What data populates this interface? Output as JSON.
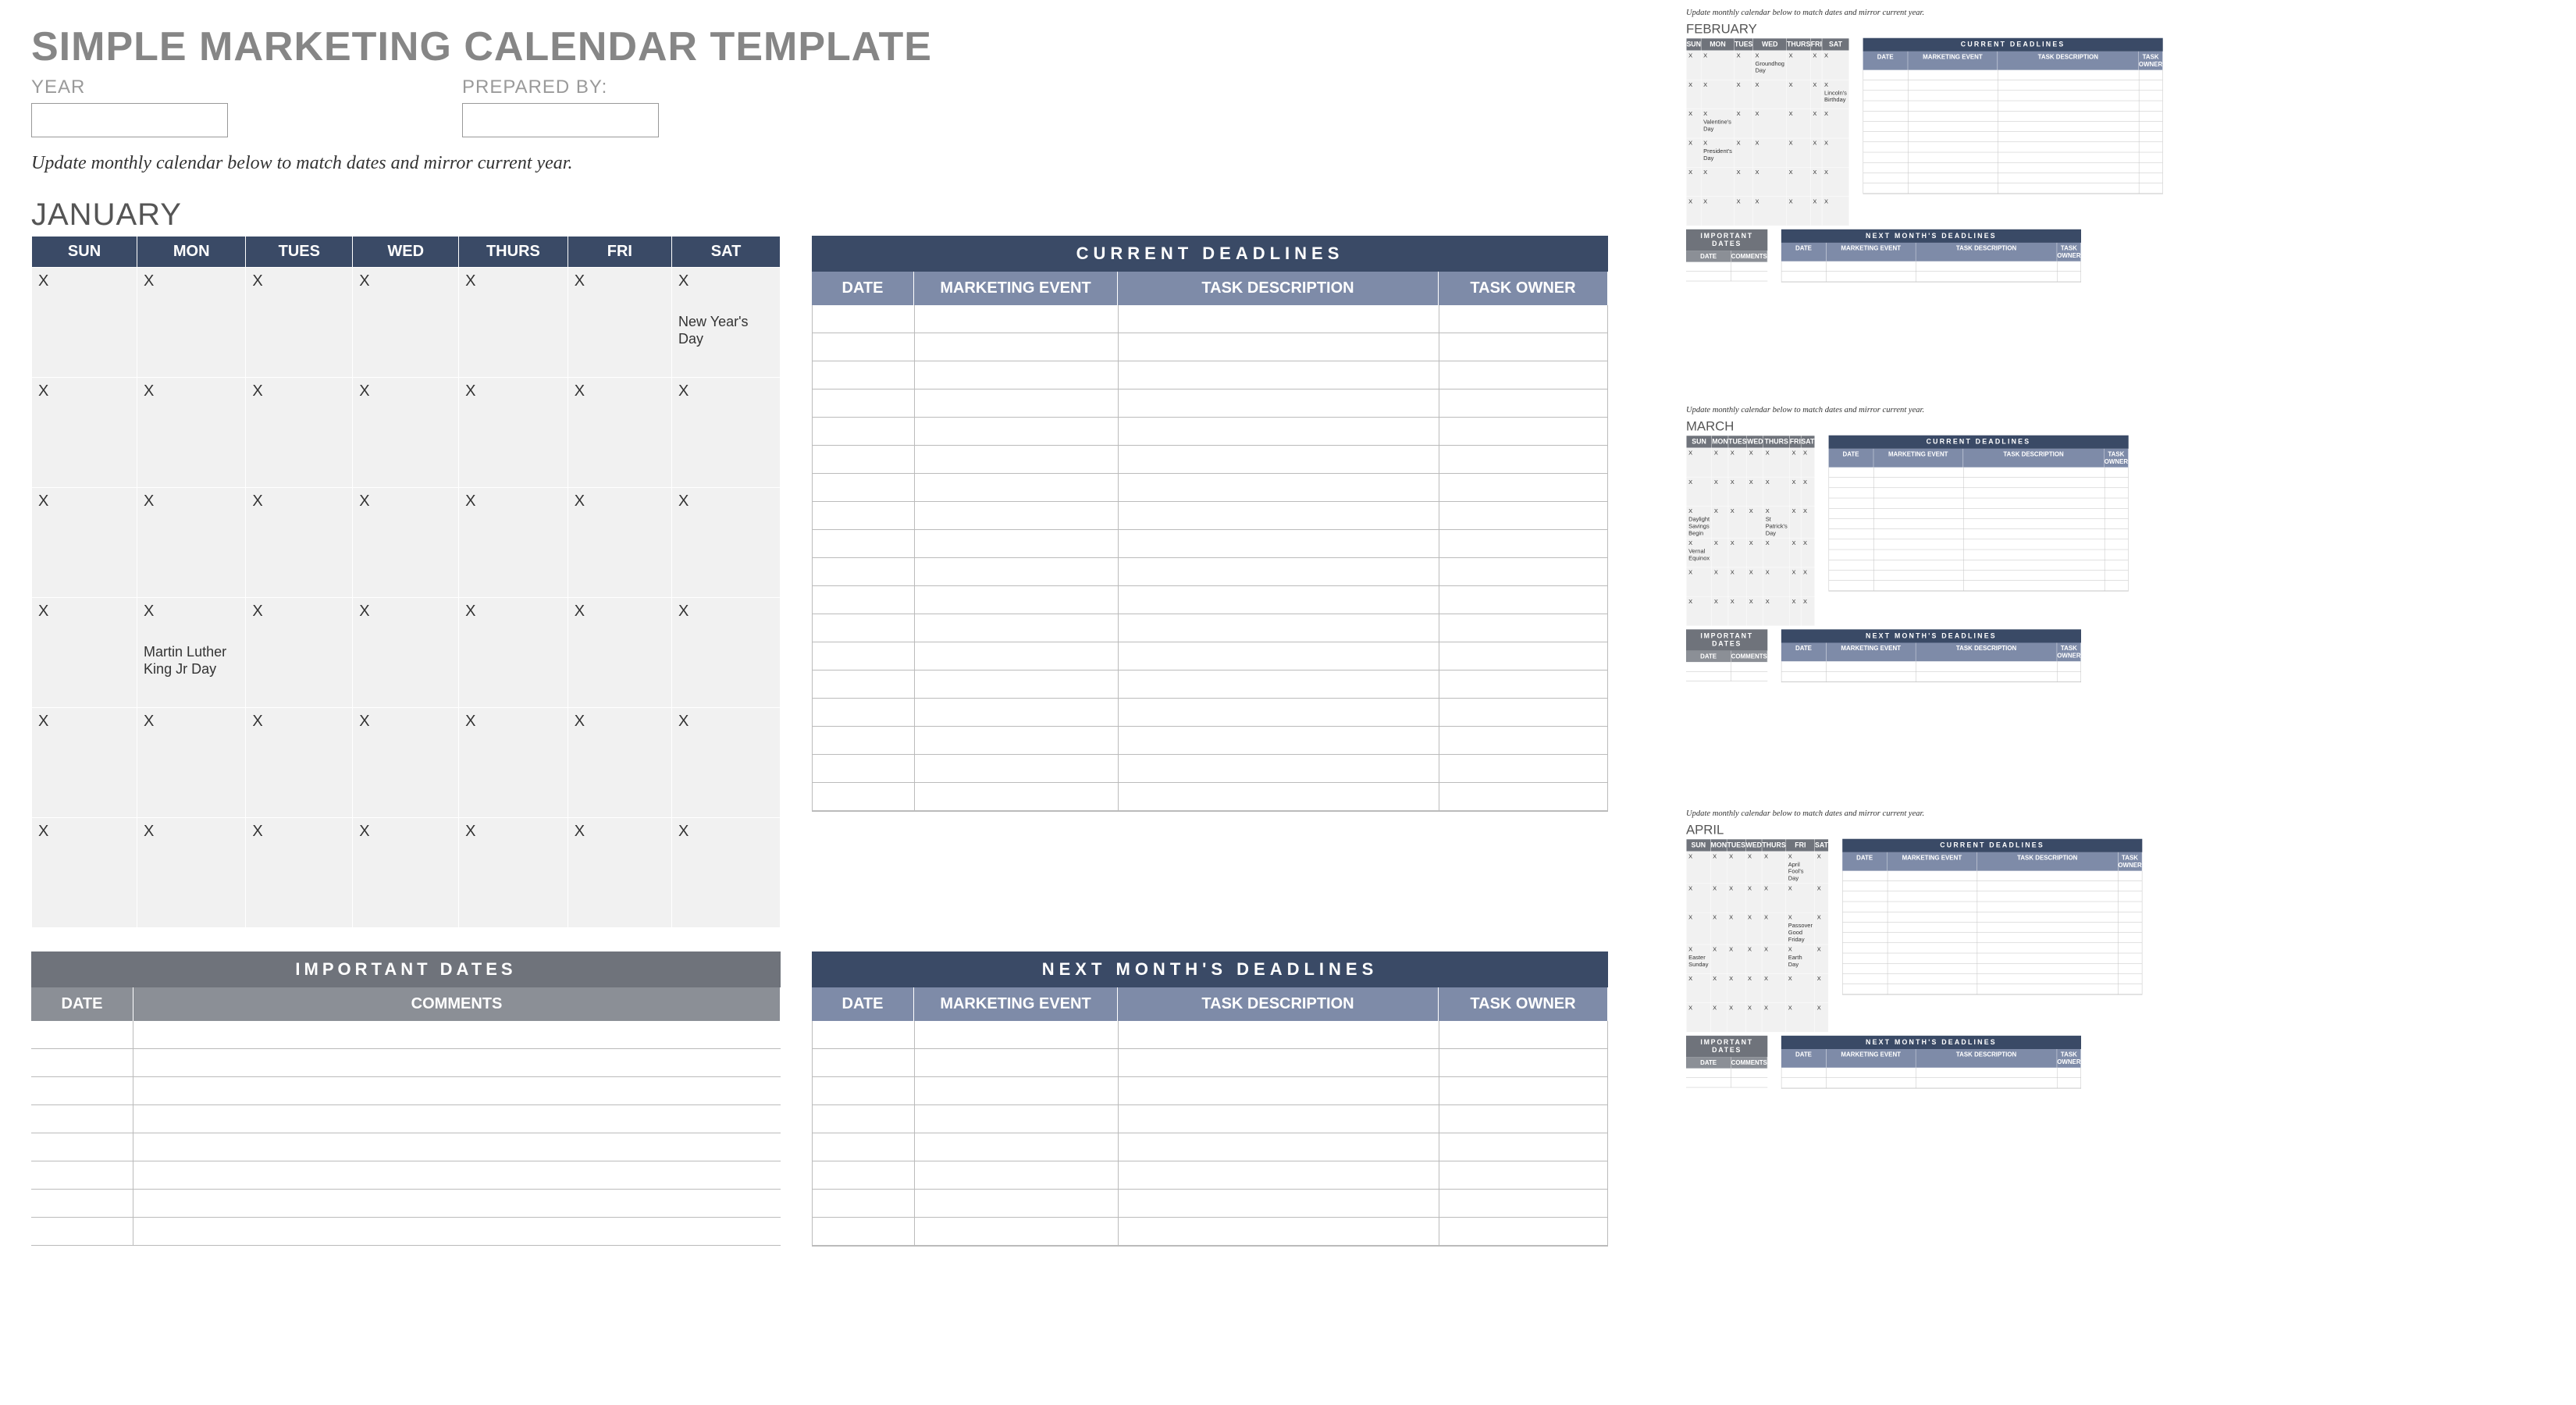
{
  "title": "SIMPLE MARKETING CALENDAR TEMPLATE",
  "meta": {
    "year_label": "YEAR",
    "prepared_by_label": "PREPARED BY:"
  },
  "note": "Update monthly calendar below to match dates and mirror current year.",
  "day_headers": [
    "SUN",
    "MON",
    "TUES",
    "WED",
    "THURS",
    "FRI",
    "SAT"
  ],
  "deadlines": {
    "title": "CURRENT  DEADLINES",
    "cols": [
      "DATE",
      "MARKETING EVENT",
      "TASK DESCRIPTION",
      "TASK OWNER"
    ]
  },
  "next_deadlines": {
    "title": "NEXT  MONTH'S  DEADLINES",
    "cols": [
      "DATE",
      "MARKETING EVENT",
      "TASK DESCRIPTION",
      "TASK OWNER"
    ]
  },
  "important": {
    "title": "IMPORTANT  DATES",
    "cols": [
      "DATE",
      "COMMENTS"
    ]
  },
  "main_month": {
    "name": "JANUARY",
    "weeks": [
      [
        {
          "x": "X"
        },
        {
          "x": "X"
        },
        {
          "x": "X"
        },
        {
          "x": "X"
        },
        {
          "x": "X"
        },
        {
          "x": "X"
        },
        {
          "x": "X",
          "ev": "New Year's Day"
        }
      ],
      [
        {
          "x": "X"
        },
        {
          "x": "X"
        },
        {
          "x": "X"
        },
        {
          "x": "X"
        },
        {
          "x": "X"
        },
        {
          "x": "X"
        },
        {
          "x": "X"
        }
      ],
      [
        {
          "x": "X"
        },
        {
          "x": "X"
        },
        {
          "x": "X"
        },
        {
          "x": "X"
        },
        {
          "x": "X"
        },
        {
          "x": "X"
        },
        {
          "x": "X"
        }
      ],
      [
        {
          "x": "X"
        },
        {
          "x": "X",
          "ev": "Martin Luther King Jr Day"
        },
        {
          "x": "X"
        },
        {
          "x": "X"
        },
        {
          "x": "X"
        },
        {
          "x": "X"
        },
        {
          "x": "X"
        }
      ],
      [
        {
          "x": "X"
        },
        {
          "x": "X"
        },
        {
          "x": "X"
        },
        {
          "x": "X"
        },
        {
          "x": "X"
        },
        {
          "x": "X"
        },
        {
          "x": "X"
        }
      ],
      [
        {
          "x": "X"
        },
        {
          "x": "X"
        },
        {
          "x": "X"
        },
        {
          "x": "X"
        },
        {
          "x": "X"
        },
        {
          "x": "X"
        },
        {
          "x": "X"
        }
      ]
    ]
  },
  "mini_months": [
    {
      "name": "FEBRUARY",
      "weeks": [
        [
          {
            "x": "X"
          },
          {
            "x": "X"
          },
          {
            "x": "X"
          },
          {
            "x": "X",
            "ev": "Groundhog Day"
          },
          {
            "x": "X"
          },
          {
            "x": "X"
          },
          {
            "x": "X"
          }
        ],
        [
          {
            "x": "X"
          },
          {
            "x": "X"
          },
          {
            "x": "X"
          },
          {
            "x": "X"
          },
          {
            "x": "X"
          },
          {
            "x": "X"
          },
          {
            "x": "X",
            "ev": "Lincoln's Birthday"
          }
        ],
        [
          {
            "x": "X"
          },
          {
            "x": "X",
            "ev": "Valentine's Day"
          },
          {
            "x": "X"
          },
          {
            "x": "X"
          },
          {
            "x": "X"
          },
          {
            "x": "X"
          },
          {
            "x": "X"
          }
        ],
        [
          {
            "x": "X"
          },
          {
            "x": "X",
            "ev": "President's Day"
          },
          {
            "x": "X"
          },
          {
            "x": "X"
          },
          {
            "x": "X"
          },
          {
            "x": "X"
          },
          {
            "x": "X"
          }
        ],
        [
          {
            "x": "X"
          },
          {
            "x": "X"
          },
          {
            "x": "X"
          },
          {
            "x": "X"
          },
          {
            "x": "X"
          },
          {
            "x": "X"
          },
          {
            "x": "X"
          }
        ],
        [
          {
            "x": "X"
          },
          {
            "x": "X"
          },
          {
            "x": "X"
          },
          {
            "x": "X"
          },
          {
            "x": "X"
          },
          {
            "x": "X"
          },
          {
            "x": "X"
          }
        ]
      ]
    },
    {
      "name": "MARCH",
      "weeks": [
        [
          {
            "x": "X"
          },
          {
            "x": "X"
          },
          {
            "x": "X"
          },
          {
            "x": "X"
          },
          {
            "x": "X"
          },
          {
            "x": "X"
          },
          {
            "x": "X"
          }
        ],
        [
          {
            "x": "X"
          },
          {
            "x": "X"
          },
          {
            "x": "X"
          },
          {
            "x": "X"
          },
          {
            "x": "X"
          },
          {
            "x": "X"
          },
          {
            "x": "X"
          }
        ],
        [
          {
            "x": "X",
            "ev": "Daylight Savings Begin"
          },
          {
            "x": "X"
          },
          {
            "x": "X"
          },
          {
            "x": "X"
          },
          {
            "x": "X",
            "ev": "St Patrick's Day"
          },
          {
            "x": "X"
          },
          {
            "x": "X"
          }
        ],
        [
          {
            "x": "X",
            "ev": "Vernal Equinox"
          },
          {
            "x": "X"
          },
          {
            "x": "X"
          },
          {
            "x": "X"
          },
          {
            "x": "X"
          },
          {
            "x": "X"
          },
          {
            "x": "X"
          }
        ],
        [
          {
            "x": "X"
          },
          {
            "x": "X"
          },
          {
            "x": "X"
          },
          {
            "x": "X"
          },
          {
            "x": "X"
          },
          {
            "x": "X"
          },
          {
            "x": "X"
          }
        ],
        [
          {
            "x": "X"
          },
          {
            "x": "X"
          },
          {
            "x": "X"
          },
          {
            "x": "X"
          },
          {
            "x": "X"
          },
          {
            "x": "X"
          },
          {
            "x": "X"
          }
        ]
      ]
    },
    {
      "name": "APRIL",
      "weeks": [
        [
          {
            "x": "X"
          },
          {
            "x": "X"
          },
          {
            "x": "X"
          },
          {
            "x": "X"
          },
          {
            "x": "X"
          },
          {
            "x": "X",
            "ev": "April Fool's Day"
          },
          {
            "x": "X"
          }
        ],
        [
          {
            "x": "X"
          },
          {
            "x": "X"
          },
          {
            "x": "X"
          },
          {
            "x": "X"
          },
          {
            "x": "X"
          },
          {
            "x": "X"
          },
          {
            "x": "X"
          }
        ],
        [
          {
            "x": "X"
          },
          {
            "x": "X"
          },
          {
            "x": "X"
          },
          {
            "x": "X"
          },
          {
            "x": "X"
          },
          {
            "x": "X",
            "ev": "Passover Good Friday"
          },
          {
            "x": "X"
          }
        ],
        [
          {
            "x": "X",
            "ev": "Easter Sunday"
          },
          {
            "x": "X"
          },
          {
            "x": "X"
          },
          {
            "x": "X"
          },
          {
            "x": "X"
          },
          {
            "x": "X",
            "ev": "Earth Day"
          },
          {
            "x": "X"
          }
        ],
        [
          {
            "x": "X"
          },
          {
            "x": "X"
          },
          {
            "x": "X"
          },
          {
            "x": "X"
          },
          {
            "x": "X"
          },
          {
            "x": "X"
          },
          {
            "x": "X"
          }
        ],
        [
          {
            "x": "X"
          },
          {
            "x": "X"
          },
          {
            "x": "X"
          },
          {
            "x": "X"
          },
          {
            "x": "X"
          },
          {
            "x": "X"
          },
          {
            "x": "X"
          }
        ]
      ]
    }
  ]
}
